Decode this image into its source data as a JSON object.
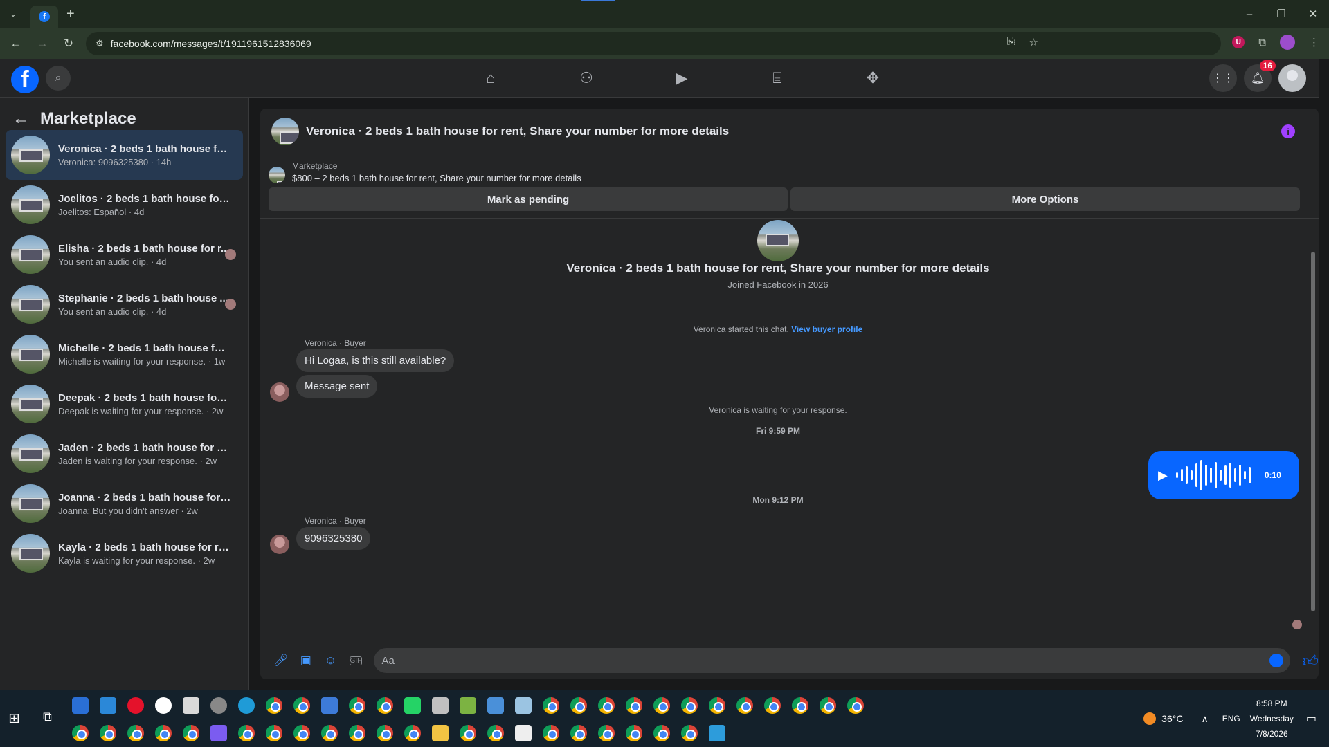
{
  "browser": {
    "url": "facebook.com/messages/t/1911961512836069",
    "favicon_letter": "f",
    "window_controls": [
      "–",
      "❐",
      "✕"
    ]
  },
  "fb_header": {
    "logo_letter": "f",
    "notification_count": "16",
    "nav_icons": [
      "home-icon",
      "friends-icon",
      "video-icon",
      "marketplace-icon",
      "gaming-icon"
    ]
  },
  "sidebar": {
    "title": "Marketplace",
    "conversations": [
      {
        "title": "Veronica · 2 beds 1 bath house for ...",
        "subtitle": "Veronica: 9096325380 · 14h",
        "active": true
      },
      {
        "title": "Joelitos · 2 beds 1 bath house for r...",
        "subtitle": "Joelitos: Español · 4d"
      },
      {
        "title": "Elisha · 2 beds 1 bath house for r...",
        "subtitle": "You sent an audio clip. · 4d"
      },
      {
        "title": "Stephanie · 2 beds 1 bath house ...",
        "subtitle": "You sent an audio clip. · 4d"
      },
      {
        "title": "Michelle · 2 beds 1 bath house for ...",
        "subtitle": "Michelle is waiting for your response. · 1w"
      },
      {
        "title": "Deepak · 2 beds 1 bath house for r...",
        "subtitle": "Deepak is waiting for your response. · 2w"
      },
      {
        "title": "Jaden · 2 beds 1 bath house for re...",
        "subtitle": "Jaden is waiting for your response. · 2w"
      },
      {
        "title": "Joanna · 2 beds 1 bath house for r...",
        "subtitle": "Joanna: But you didn't answer · 2w"
      },
      {
        "title": "Kayla · 2 beds 1 bath house for ren...",
        "subtitle": "Kayla is waiting for your response. · 2w"
      }
    ]
  },
  "chat": {
    "header_title": "Veronica · 2 beds 1 bath house for rent, Share your number for more details",
    "listing_label": "Marketplace",
    "listing_text": "$800 – 2 beds 1 bath house for rent, Share your number for more details",
    "mark_pending": "Mark as pending",
    "more_options": "More Options",
    "profile_title": "Veronica · 2 beds 1 bath house for rent, Share your number for more details",
    "profile_sub": "Joined Facebook in 2026",
    "started_text": "Veronica started this chat.",
    "view_buyer": "View buyer profile",
    "sender1": "Veronica · Buyer",
    "msg1": "Hi Logaa, is this still available?",
    "msg2": "Message sent",
    "waiting": "Veronica is waiting for your response.",
    "ts1": "Fri 9:59 PM",
    "audio_play": "▶",
    "audio_duration": "0:10",
    "ts2": "Mon 9:12 PM",
    "sender2": "Veronica · Buyer",
    "msg3": "9096325380",
    "composer_placeholder": "Aa",
    "gif_label": "GIF"
  },
  "taskbar": {
    "temperature": "36°C",
    "language": "ENG",
    "time": "8:58 PM",
    "day": "Wednesday",
    "date": "7/8/2026"
  }
}
